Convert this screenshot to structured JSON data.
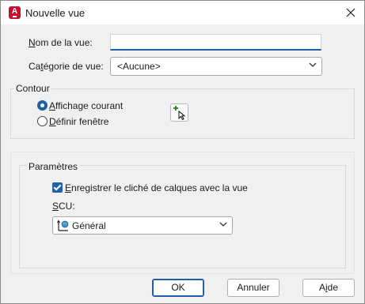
{
  "window": {
    "title": "Nouvelle vue",
    "app_icon_letter": "A",
    "close_symbol": "✕"
  },
  "form": {
    "view_name_label_accel": "N",
    "view_name_label_rest": "om de la vue:",
    "view_name_value": "",
    "category_label_prefix": "Ca",
    "category_label_accel": "t",
    "category_label_rest": "égorie de vue:",
    "category_value": "<Aucune>"
  },
  "boundary": {
    "title": "Contour",
    "current_display_accel": "A",
    "current_display_rest": "ffichage courant",
    "define_window_accel": "D",
    "define_window_rest": "éfinir fenêtre",
    "selected": "current_display"
  },
  "settings": {
    "title": "Paramètres",
    "save_layer_snapshot_accel": "E",
    "save_layer_snapshot_rest": "nregistrer le cliché de calques avec la vue",
    "save_layer_snapshot_checked": true,
    "ucs_label_accel": "S",
    "ucs_label_rest": "CU:",
    "ucs_value": "Général"
  },
  "buttons": {
    "ok": "OK",
    "cancel": "Annuler",
    "help_prefix": "A",
    "help_accel": "i",
    "help_rest": "de"
  },
  "colors": {
    "accent": "#1f5fa8",
    "app_icon": "#c8102e"
  }
}
